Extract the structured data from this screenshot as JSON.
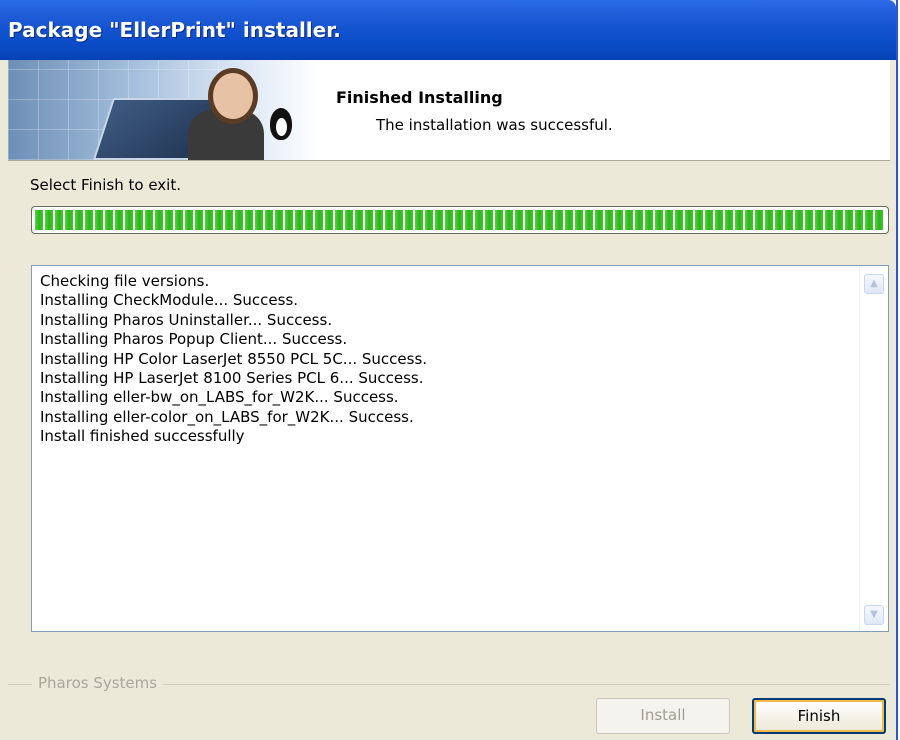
{
  "window": {
    "title": "Package \"EllerPrint\" installer."
  },
  "banner": {
    "heading": "Finished Installing",
    "subheading": "The installation was successful."
  },
  "instruction": "Select Finish to exit.",
  "progress": {
    "percent": 100,
    "color": "#3cc82a"
  },
  "log": {
    "lines": [
      "Checking file versions.",
      "Installing CheckModule... Success.",
      "Installing Pharos Uninstaller... Success.",
      "Installing Pharos Popup Client... Success.",
      "Installing HP Color LaserJet 8550 PCL 5C... Success.",
      "Installing HP LaserJet 8100 Series PCL 6... Success.",
      "Installing eller-bw_on_LABS_for_W2K... Success.",
      "Installing eller-color_on_LABS_for_W2K... Success.",
      "Install finished successfully"
    ]
  },
  "footer": {
    "group_label": "Pharos Systems"
  },
  "buttons": {
    "install_label": "Install",
    "finish_label": "Finish"
  },
  "colors": {
    "titlebar": "#0a4cc8",
    "dialog_bg": "#ece9d8"
  }
}
